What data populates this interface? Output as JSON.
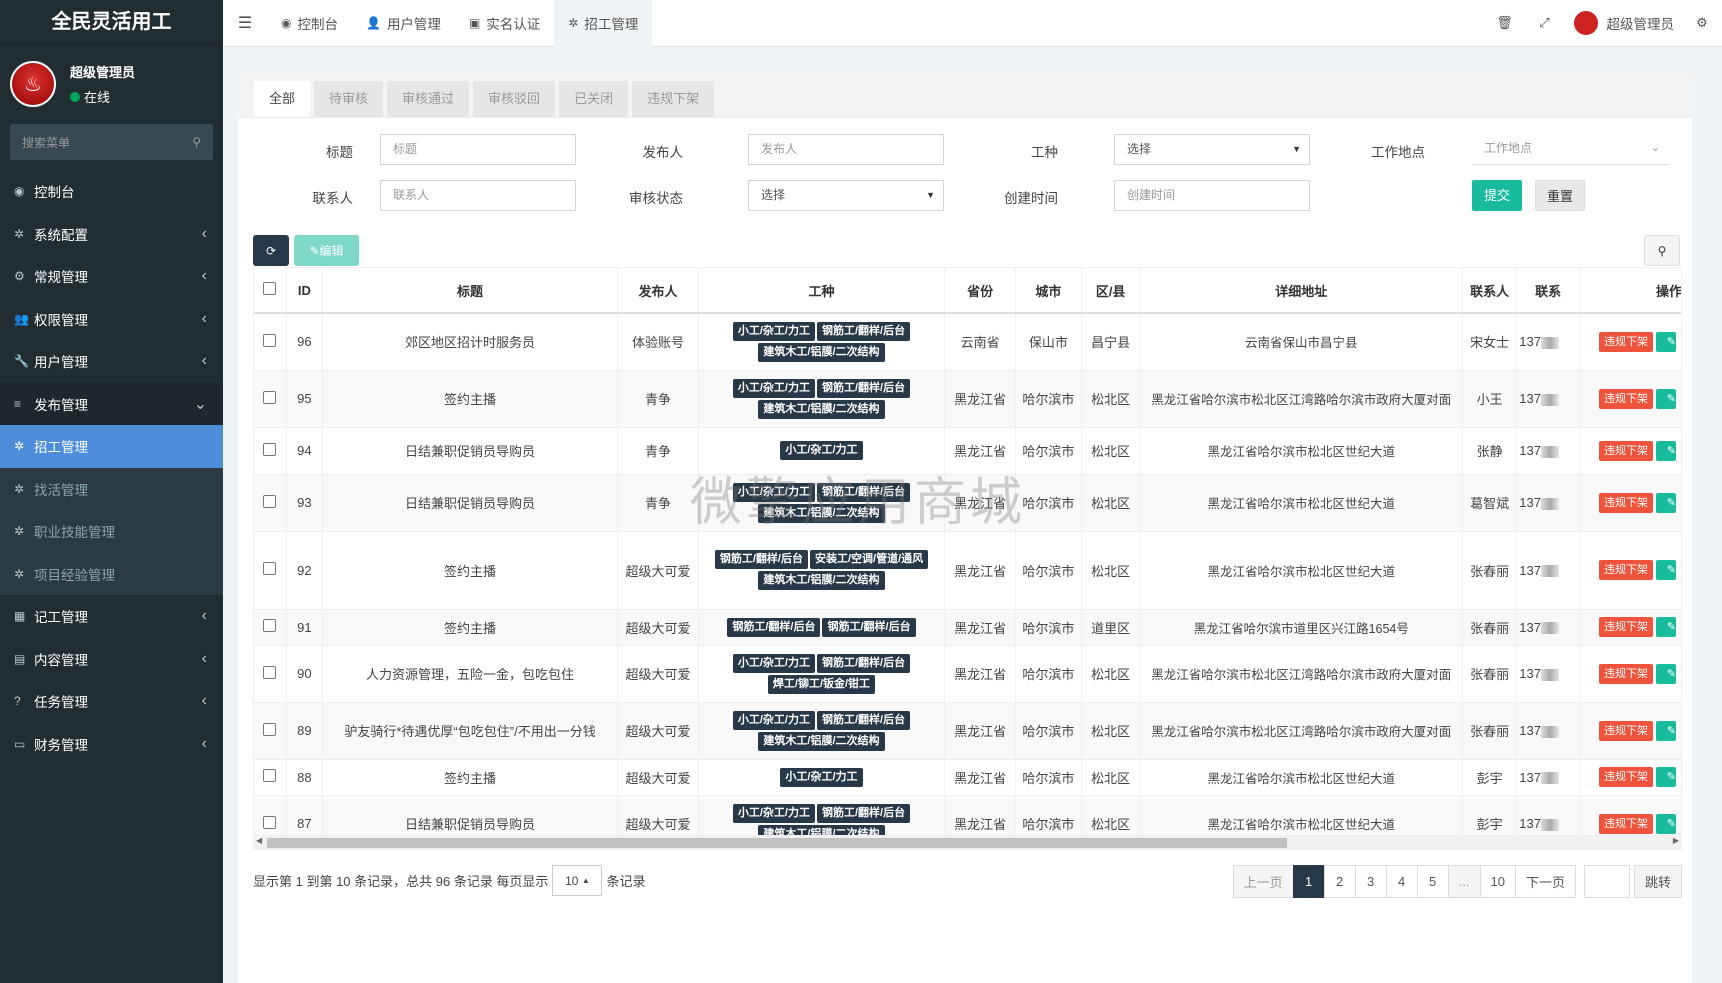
{
  "app": {
    "title": "全民灵活用工"
  },
  "user": {
    "name": "超级管理员",
    "status": "在线"
  },
  "sidebar": {
    "search_placeholder": "搜索菜单",
    "items": [
      {
        "label": "控制台",
        "icon": "dashboard-icon",
        "arrow": false,
        "type": "top"
      },
      {
        "label": "系统配置",
        "icon": "gear-icon",
        "arrow": true,
        "type": "top"
      },
      {
        "label": "常规管理",
        "icon": "gears-icon",
        "arrow": true,
        "type": "top"
      },
      {
        "label": "权限管理",
        "icon": "group-icon",
        "arrow": true,
        "type": "top"
      },
      {
        "label": "用户管理",
        "icon": "wrench-icon",
        "arrow": true,
        "type": "top"
      },
      {
        "label": "发布管理",
        "icon": "list-icon",
        "arrow": "down",
        "type": "open"
      },
      {
        "label": "招工管理",
        "icon": "gear-icon",
        "arrow": false,
        "type": "active"
      },
      {
        "label": "找活管理",
        "icon": "gear-icon",
        "arrow": false,
        "type": "sub"
      },
      {
        "label": "职业技能管理",
        "icon": "gear-icon",
        "arrow": false,
        "type": "sub"
      },
      {
        "label": "项目经验管理",
        "icon": "gear-icon",
        "arrow": false,
        "type": "sub"
      },
      {
        "label": "记工管理",
        "icon": "calendar-icon",
        "arrow": true,
        "type": "top"
      },
      {
        "label": "内容管理",
        "icon": "file-icon",
        "arrow": true,
        "type": "top"
      },
      {
        "label": "任务管理",
        "icon": "question-icon",
        "arrow": true,
        "type": "top"
      },
      {
        "label": "财务管理",
        "icon": "money-icon",
        "arrow": true,
        "type": "top"
      }
    ]
  },
  "topbar": {
    "tabs": [
      {
        "label": "控制台",
        "icon": "dashboard-icon"
      },
      {
        "label": "用户管理",
        "icon": "user-icon"
      },
      {
        "label": "实名认证",
        "icon": "idcard-icon"
      },
      {
        "label": "招工管理",
        "icon": "gear-icon",
        "active": true
      }
    ],
    "user_name": "超级管理员"
  },
  "subtabs": [
    "全部",
    "待审核",
    "审核通过",
    "审核驳回",
    "已关闭",
    "违规下架"
  ],
  "filters": {
    "title_label": "标题",
    "title_placeholder": "标题",
    "publisher_label": "发布人",
    "publisher_placeholder": "发布人",
    "worktype_label": "工种",
    "worktype_value": "选择",
    "location_label": "工作地点",
    "location_placeholder": "工作地点",
    "contact_label": "联系人",
    "contact_placeholder": "联系人",
    "status_label": "审核状态",
    "status_value": "选择",
    "created_label": "创建时间",
    "created_placeholder": "创建时间",
    "submit": "提交",
    "reset": "重置"
  },
  "toolbar": {
    "edit": "编辑"
  },
  "table": {
    "headers": [
      "ID",
      "标题",
      "发布人",
      "工种",
      "省份",
      "城市",
      "区/县",
      "详细地址",
      "联系人",
      "联系",
      "操作"
    ],
    "action_offline": "违规下架",
    "rows": [
      {
        "id": "96",
        "title": "郊区地区招计时服务员",
        "publisher": "体验账号",
        "tags": [
          "小工/杂工/力工",
          "钢筋工/翻样/后台",
          "建筑木工/铝膜/二次结构"
        ],
        "province": "云南省",
        "city": "保山市",
        "district": "昌宁县",
        "address": "云南省保山市昌宁县",
        "contact": "宋女士",
        "phone": "137"
      },
      {
        "id": "95",
        "title": "签约主播",
        "publisher": "青争",
        "tags": [
          "小工/杂工/力工",
          "钢筋工/翻样/后台",
          "建筑木工/铝膜/二次结构"
        ],
        "province": "黑龙江省",
        "city": "哈尔滨市",
        "district": "松北区",
        "address": "黑龙江省哈尔滨市松北区江湾路哈尔滨市政府大厦对面",
        "contact": "小王",
        "phone": "137"
      },
      {
        "id": "94",
        "title": "日结兼职促销员导购员",
        "publisher": "青争",
        "tags": [
          "小工/杂工/力工"
        ],
        "province": "黑龙江省",
        "city": "哈尔滨市",
        "district": "松北区",
        "address": "黑龙江省哈尔滨市松北区世纪大道",
        "contact": "张静",
        "phone": "137"
      },
      {
        "id": "93",
        "title": "日结兼职促销员导购员",
        "publisher": "青争",
        "tags": [
          "小工/杂工/力工",
          "钢筋工/翻样/后台",
          "建筑木工/铝膜/二次结构"
        ],
        "province": "黑龙江省",
        "city": "哈尔滨市",
        "district": "松北区",
        "address": "黑龙江省哈尔滨市松北区世纪大道",
        "contact": "葛智斌",
        "phone": "137"
      },
      {
        "id": "92",
        "title": "签约主播",
        "publisher": "超级大可爱",
        "tags": [
          "钢筋工/翻样/后台",
          "安装工/空调/管道/通风",
          "建筑木工/铝膜/二次结构"
        ],
        "province": "黑龙江省",
        "city": "哈尔滨市",
        "district": "松北区",
        "address": "黑龙江省哈尔滨市松北区世纪大道",
        "contact": "张春丽",
        "phone": "137"
      },
      {
        "id": "91",
        "title": "签约主播",
        "publisher": "超级大可爱",
        "tags": [
          "钢筋工/翻样/后台",
          "钢筋工/翻样/后台"
        ],
        "province": "黑龙江省",
        "city": "哈尔滨市",
        "district": "道里区",
        "address": "黑龙江省哈尔滨市道里区兴江路1654号",
        "contact": "张春丽",
        "phone": "137"
      },
      {
        "id": "90",
        "title": "人力资源管理，五险一金，包吃包住",
        "publisher": "超级大可爱",
        "tags": [
          "小工/杂工/力工",
          "钢筋工/翻样/后台",
          "焊工/铆工/钣金/钳工"
        ],
        "province": "黑龙江省",
        "city": "哈尔滨市",
        "district": "松北区",
        "address": "黑龙江省哈尔滨市松北区江湾路哈尔滨市政府大厦对面",
        "contact": "张春丽",
        "phone": "137"
      },
      {
        "id": "89",
        "title": "驴友骑行*待遇优厚“包吃包住”/不用出一分钱",
        "publisher": "超级大可爱",
        "tags": [
          "小工/杂工/力工",
          "钢筋工/翻样/后台",
          "建筑木工/铝膜/二次结构"
        ],
        "province": "黑龙江省",
        "city": "哈尔滨市",
        "district": "松北区",
        "address": "黑龙江省哈尔滨市松北区江湾路哈尔滨市政府大厦对面",
        "contact": "张春丽",
        "phone": "137"
      },
      {
        "id": "88",
        "title": "签约主播",
        "publisher": "超级大可爱",
        "tags": [
          "小工/杂工/力工"
        ],
        "province": "黑龙江省",
        "city": "哈尔滨市",
        "district": "松北区",
        "address": "黑龙江省哈尔滨市松北区世纪大道",
        "contact": "彭宇",
        "phone": "137"
      },
      {
        "id": "87",
        "title": "日结兼职促销员导购员",
        "publisher": "超级大可爱",
        "tags": [
          "小工/杂工/力工",
          "钢筋工/翻样/后台",
          "建筑木工/铝膜/二次结构"
        ],
        "province": "黑龙江省",
        "city": "哈尔滨市",
        "district": "松北区",
        "address": "黑龙江省哈尔滨市松北区世纪大道",
        "contact": "彭宇",
        "phone": "137"
      }
    ]
  },
  "pagination": {
    "info_prefix": "显示第 1 到第 10 条记录，总共 96 条记录 每页显示",
    "page_size": "10",
    "info_suffix": "条记录",
    "prev": "上一页",
    "pages": [
      "1",
      "2",
      "3",
      "4",
      "5",
      "...",
      "10"
    ],
    "next": "下一页",
    "jump": "跳转"
  },
  "watermark": "微擎应用商城"
}
